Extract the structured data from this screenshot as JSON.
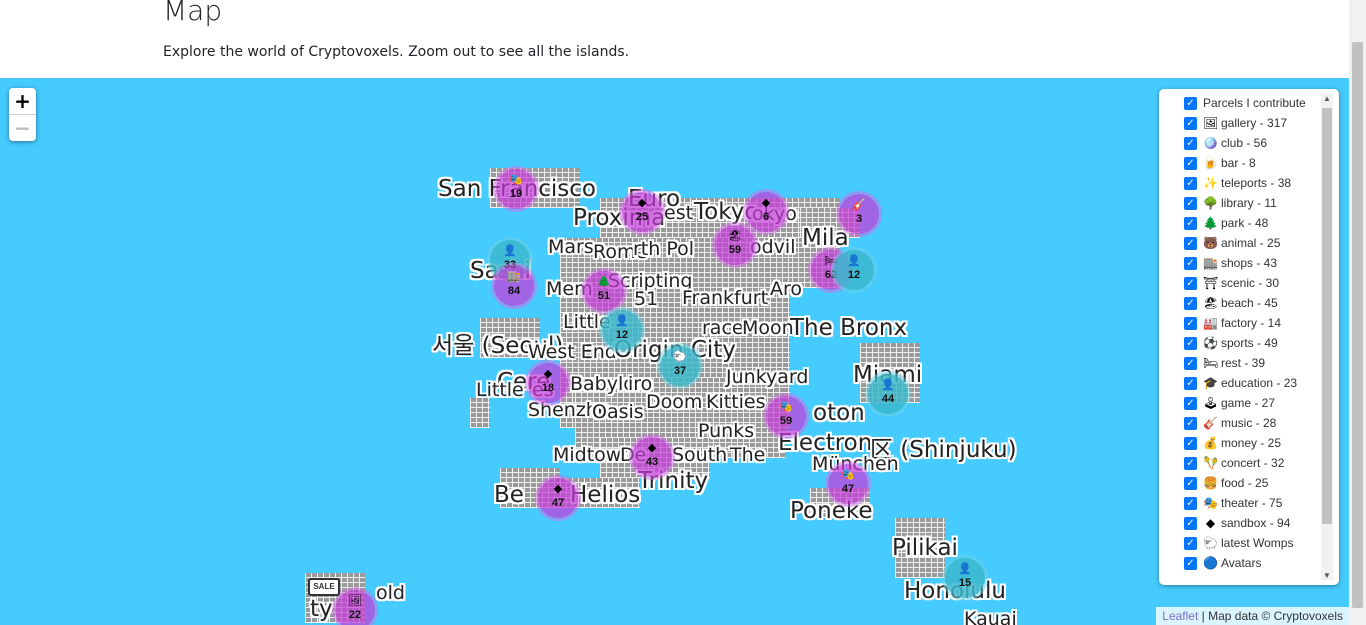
{
  "header": {
    "title": "Map",
    "subtitle": "Explore the world of Cryptovoxels. Zoom out to see all the islands."
  },
  "zoom": {
    "in": "+",
    "out": "−"
  },
  "map_labels": [
    {
      "text": "San Francisco",
      "size": "big"
    },
    {
      "text": "Euro",
      "size": "big"
    },
    {
      "text": "Proxima",
      "size": "big"
    },
    {
      "text": "est",
      "size": "mid"
    },
    {
      "text": "Tokyo",
      "size": "big"
    },
    {
      "text": "okyo",
      "size": "mid"
    },
    {
      "text": "Mila",
      "size": "big"
    },
    {
      "text": "Mars",
      "size": "mid"
    },
    {
      "text": "Rome",
      "size": "mid"
    },
    {
      "text": "rth Pol",
      "size": "mid"
    },
    {
      "text": "odvil",
      "size": "mid"
    },
    {
      "text": "Sa",
      "size": "big"
    },
    {
      "text": "shi",
      "size": "big"
    },
    {
      "text": "Scripting",
      "size": "mid"
    },
    {
      "text": "Mem",
      "size": "mid"
    },
    {
      "text": "Aro",
      "size": "mid"
    },
    {
      "text": "Frankfurt",
      "size": "mid"
    },
    {
      "text": "51",
      "size": "mid"
    },
    {
      "text": "Little",
      "size": "mid"
    },
    {
      "text": "race",
      "size": "mid"
    },
    {
      "text": "Moon",
      "size": "mid"
    },
    {
      "text": "The Bronx",
      "size": "big"
    },
    {
      "text": "서울 (Seoul)",
      "size": "big"
    },
    {
      "text": "West End",
      "size": "mid"
    },
    {
      "text": "Origin City",
      "size": "big"
    },
    {
      "text": "Miami",
      "size": "big"
    },
    {
      "text": "Cere",
      "size": "big"
    },
    {
      "text": "Babylon",
      "size": "mid"
    },
    {
      "text": "iro",
      "size": "mid"
    },
    {
      "text": "Junkyard",
      "size": "mid"
    },
    {
      "text": "Little",
      "size": "mid"
    },
    {
      "text": "es",
      "size": "mid"
    },
    {
      "text": "Shenzhe",
      "size": "mid"
    },
    {
      "text": "Doom",
      "size": "mid"
    },
    {
      "text": "Kitties",
      "size": "mid"
    },
    {
      "text": "Oasis",
      "size": "mid"
    },
    {
      "text": "oton",
      "size": "big"
    },
    {
      "text": "Punks",
      "size": "mid"
    },
    {
      "text": "Electron",
      "size": "big"
    },
    {
      "text": "区 (Shinjuku)",
      "size": "big"
    },
    {
      "text": "Midtown",
      "size": "mid"
    },
    {
      "text": "De",
      "size": "mid"
    },
    {
      "text": "South",
      "size": "mid"
    },
    {
      "text": "The",
      "size": "mid"
    },
    {
      "text": "München",
      "size": "mid"
    },
    {
      "text": "Trinity",
      "size": "big"
    },
    {
      "text": "Be",
      "size": "big"
    },
    {
      "text": "Helios",
      "size": "big"
    },
    {
      "text": "Poneke",
      "size": "big"
    },
    {
      "text": "Pilikai",
      "size": "big"
    },
    {
      "text": "Honolulu",
      "size": "big"
    },
    {
      "text": "Kauai",
      "size": "mid"
    },
    {
      "text": "old",
      "size": "mid"
    },
    {
      "text": "ty",
      "size": "big"
    }
  ],
  "clusters": [
    {
      "count": "19",
      "color": "pink",
      "icon": "theater-icon"
    },
    {
      "count": "25",
      "color": "pink",
      "icon": "sandbox-icon"
    },
    {
      "count": "6",
      "color": "pink",
      "icon": "sandbox-icon"
    },
    {
      "count": "3",
      "color": "pink",
      "icon": "music-icon"
    },
    {
      "count": "59",
      "color": "pink",
      "icon": "beach-icon"
    },
    {
      "count": "33",
      "color": "blue",
      "icon": "avatar-icon"
    },
    {
      "count": "84",
      "color": "pink",
      "icon": "shops-icon"
    },
    {
      "count": "62",
      "color": "pink",
      "icon": "rest-icon"
    },
    {
      "count": "12",
      "color": "blue",
      "icon": "avatar-icon"
    },
    {
      "count": "51",
      "color": "pink",
      "icon": "park-icon"
    },
    {
      "count": "12",
      "color": "blue",
      "icon": "avatar-icon"
    },
    {
      "count": "37",
      "color": "blue",
      "icon": "womp-icon"
    },
    {
      "count": "18",
      "color": "pink",
      "icon": "sandbox-icon"
    },
    {
      "count": "44",
      "color": "blue",
      "icon": "avatar-icon"
    },
    {
      "count": "59",
      "color": "pink",
      "icon": "theater-icon"
    },
    {
      "count": "43",
      "color": "pink",
      "icon": "sandbox-icon"
    },
    {
      "count": "47",
      "color": "pink",
      "icon": "theater-icon"
    },
    {
      "count": "47",
      "color": "pink",
      "icon": "sandbox-icon"
    },
    {
      "count": "15",
      "color": "blue",
      "icon": "avatar-icon"
    },
    {
      "count": "22",
      "color": "pink",
      "icon": "gallery-icon"
    }
  ],
  "layers": [
    {
      "label": "Parcels I contribute",
      "icon": ""
    },
    {
      "label": "gallery - 317",
      "icon": "gallery-icon"
    },
    {
      "label": "club - 56",
      "icon": "club-icon"
    },
    {
      "label": "bar - 8",
      "icon": "bar-icon"
    },
    {
      "label": "teleports - 38",
      "icon": "teleports-icon"
    },
    {
      "label": "library - 11",
      "icon": "library-icon"
    },
    {
      "label": "park - 48",
      "icon": "park-icon"
    },
    {
      "label": "animal - 25",
      "icon": "animal-icon"
    },
    {
      "label": "shops - 43",
      "icon": "shops-icon"
    },
    {
      "label": "scenic - 30",
      "icon": "scenic-icon"
    },
    {
      "label": "beach - 45",
      "icon": "beach-icon"
    },
    {
      "label": "factory - 14",
      "icon": "factory-icon"
    },
    {
      "label": "sports - 49",
      "icon": "sports-icon"
    },
    {
      "label": "rest - 39",
      "icon": "rest-icon"
    },
    {
      "label": "education - 23",
      "icon": "education-icon"
    },
    {
      "label": "game - 27",
      "icon": "game-icon"
    },
    {
      "label": "music - 28",
      "icon": "music-icon"
    },
    {
      "label": "money - 25",
      "icon": "money-icon"
    },
    {
      "label": "concert - 32",
      "icon": "concert-icon"
    },
    {
      "label": "food - 25",
      "icon": "food-icon"
    },
    {
      "label": "theater - 75",
      "icon": "theater-icon"
    },
    {
      "label": "sandbox - 94",
      "icon": "sandbox-icon"
    },
    {
      "label": "latest Womps",
      "icon": "womp-icon"
    },
    {
      "label": "Avatars",
      "icon": "avatar-dot-icon"
    }
  ],
  "sale_sign": "SALE",
  "attribution": {
    "link": "Leaflet",
    "text": " | Map data © Cryptovoxels"
  },
  "colors": {
    "water": "#46cbff",
    "cluster_pink": "#c43cda",
    "cluster_blue": "#3cb9cd",
    "checkbox": "#0075ff"
  }
}
